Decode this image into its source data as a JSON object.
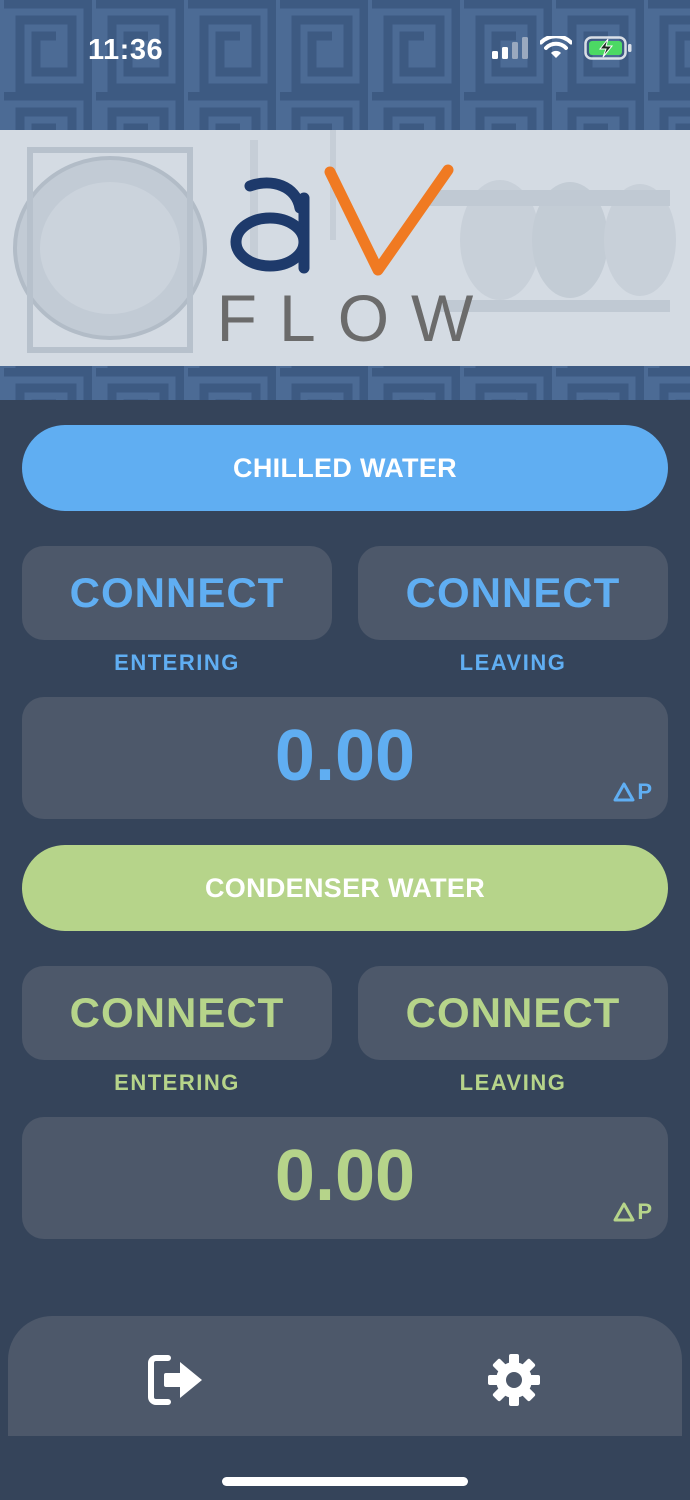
{
  "status_bar": {
    "time": "11:36",
    "icons": [
      "cellular-signal-icon",
      "wifi-icon",
      "battery-charging-icon"
    ]
  },
  "logo": {
    "brand_letters": "aV",
    "product_name": "FLOW"
  },
  "chilled_water": {
    "title": "CHILLED WATER",
    "entering_button": "CONNECT",
    "leaving_button": "CONNECT",
    "entering_label": "ENTERING",
    "leaving_label": "LEAVING",
    "value": "0.00",
    "unit_label": "P",
    "color": "#60aef2"
  },
  "condenser_water": {
    "title": "CONDENSER WATER",
    "entering_button": "CONNECT",
    "leaving_button": "CONNECT",
    "entering_label": "ENTERING",
    "leaving_label": "LEAVING",
    "value": "0.00",
    "unit_label": "P",
    "color": "#b6d48a"
  },
  "bottom_bar": {
    "icons": [
      "logout-icon",
      "gear-icon"
    ]
  },
  "colors": {
    "background": "#35445a",
    "card": "#4d586a",
    "header_pattern": "#4c6b95",
    "logo_blue": "#1e3a6b",
    "logo_orange": "#f07a22"
  }
}
